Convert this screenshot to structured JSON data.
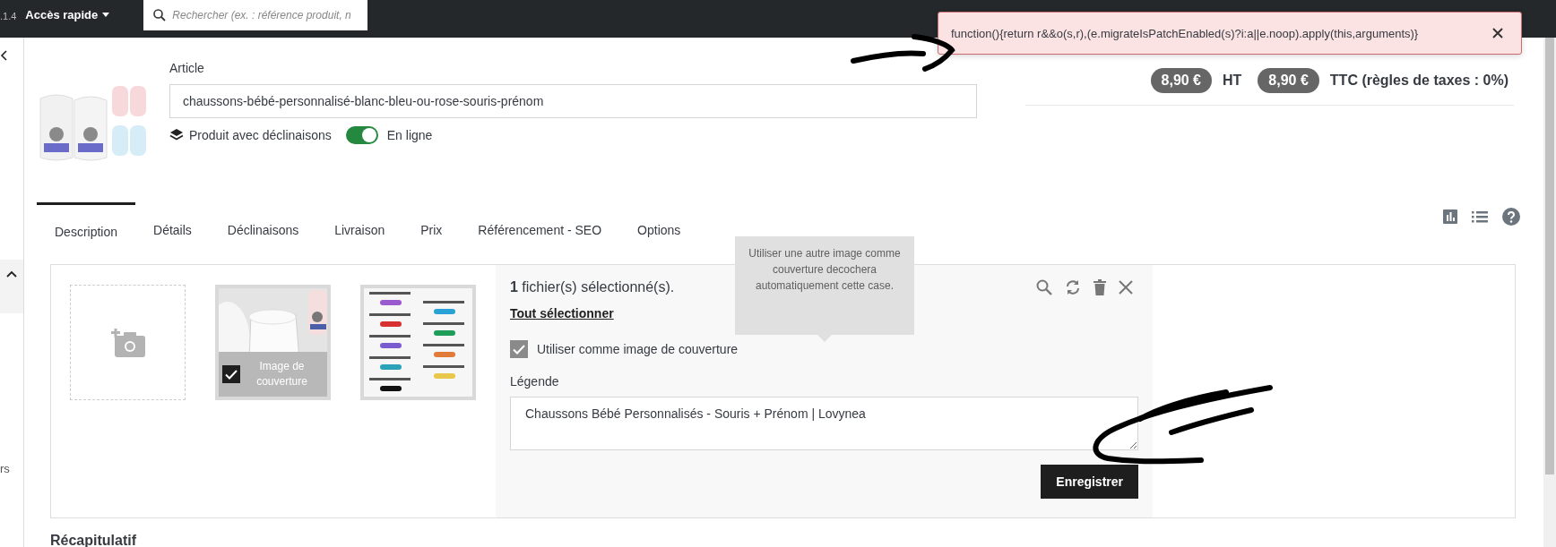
{
  "top_bar": {
    "version": ".1.4",
    "quick_access": "Accès rapide",
    "search": {
      "placeholder": "Rechercher (ex. : référence produit, n"
    }
  },
  "alert": {
    "message": "function(){return r&&o(s,r),(e.migrateIsPatchEnabled(s)?i:a||e.noop).apply(this,arguments)}"
  },
  "sidebar": {
    "label": "rs"
  },
  "product": {
    "article_label": "Article",
    "name": "chaussons-bébé-personnalisé-blanc-bleu-ou-rose-souris-prénom",
    "combinations_label": "Produit avec déclinaisons",
    "online": {
      "on": true,
      "label": "En ligne"
    }
  },
  "prices": [
    {
      "amount": "8,90 €",
      "label": "HT"
    },
    {
      "amount": "8,90 €",
      "label": "TTC (règles de taxes : 0%)"
    }
  ],
  "tabs": [
    {
      "label": "Description",
      "selected": true
    },
    {
      "label": "Détails",
      "selected": false
    },
    {
      "label": "Déclinaisons",
      "selected": false
    },
    {
      "label": "Livraison",
      "selected": false
    },
    {
      "label": "Prix",
      "selected": false
    },
    {
      "label": "Référencement - SEO",
      "selected": false
    },
    {
      "label": "Options",
      "selected": false
    }
  ],
  "images": [
    {
      "kind": "add"
    },
    {
      "kind": "picture",
      "cover": true,
      "cover_label": "Image de couverture"
    },
    {
      "kind": "picture",
      "cover": false
    }
  ],
  "file_panel": {
    "count_text": "**1** fichier(s) sélectionné(s).",
    "select_all": "Tout sélectionner",
    "use_as_cover": {
      "label": "Utiliser comme image de couverture",
      "checked": true
    },
    "caption_label": "Légende",
    "caption": "Chaussons Bébé Personnalisés - Souris + Prénom | Lovynea",
    "save": "Enregistrer"
  },
  "tooltip": "Utiliser une autre image comme couverture decochera automatiquement cette case.",
  "summary_heading": "Récapitulatif"
}
